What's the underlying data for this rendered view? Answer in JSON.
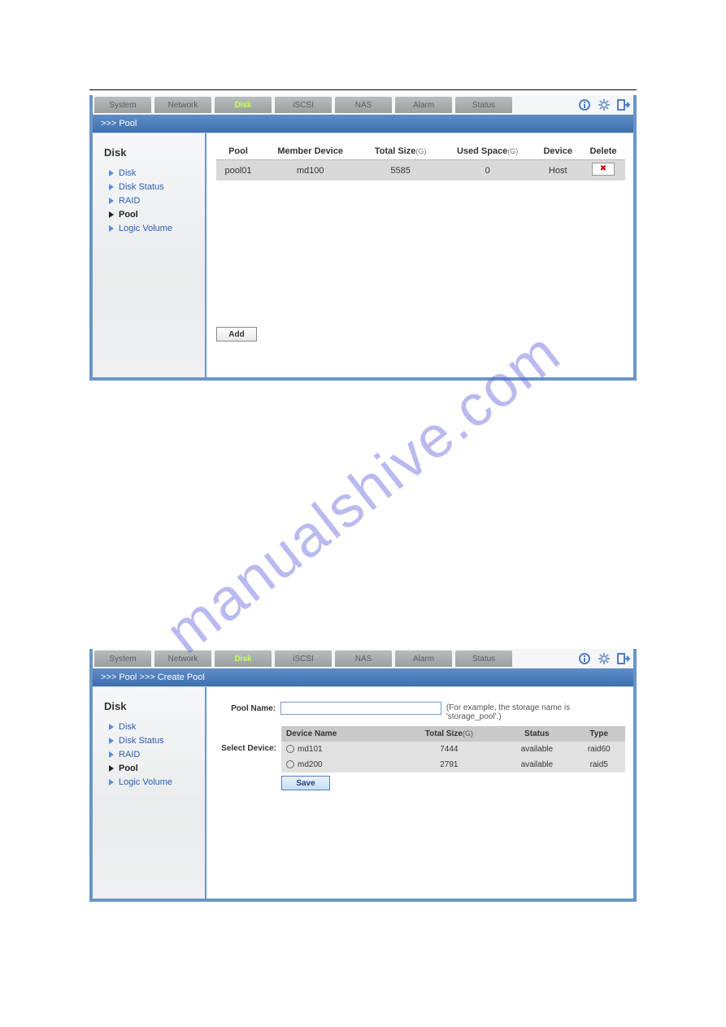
{
  "watermark": "manualshive.com",
  "screen1": {
    "tabs": [
      "System",
      "Network",
      "Disk",
      "iSCSI",
      "NAS",
      "Alarm",
      "Status"
    ],
    "activeTab": "Disk",
    "breadcrumb": ">>> Pool",
    "sidebar": {
      "header": "Disk",
      "items": [
        {
          "label": "Disk",
          "active": false
        },
        {
          "label": "Disk Status",
          "active": false
        },
        {
          "label": "RAID",
          "active": false
        },
        {
          "label": "Pool",
          "active": true
        },
        {
          "label": "Logic Volume",
          "active": false
        }
      ]
    },
    "table": {
      "cols": [
        {
          "label": "Pool",
          "unit": ""
        },
        {
          "label": "Member Device",
          "unit": ""
        },
        {
          "label": "Total Size",
          "unit": "(G)"
        },
        {
          "label": "Used Space",
          "unit": "(G)"
        },
        {
          "label": "Device",
          "unit": ""
        },
        {
          "label": "Delete",
          "unit": ""
        }
      ],
      "rows": [
        {
          "pool": "pool01",
          "member": "md100",
          "total": "5585",
          "used": "0",
          "device": "Host"
        }
      ]
    },
    "addLabel": "Add"
  },
  "screen2": {
    "tabs": [
      "System",
      "Network",
      "Disk",
      "iSCSI",
      "NAS",
      "Alarm",
      "Status"
    ],
    "activeTab": "Disk",
    "breadcrumb": ">>> Pool >>> Create Pool",
    "sidebar": {
      "header": "Disk",
      "items": [
        {
          "label": "Disk",
          "active": false
        },
        {
          "label": "Disk Status",
          "active": false
        },
        {
          "label": "RAID",
          "active": false
        },
        {
          "label": "Pool",
          "active": true
        },
        {
          "label": "Logic Volume",
          "active": false
        }
      ]
    },
    "form": {
      "poolNameLabel": "Pool Name:",
      "poolNameValue": "",
      "poolNameHint": "(For example, the storage name is 'storage_pool'.)",
      "selectDeviceLabel": "Select Device:",
      "cols": [
        {
          "label": "Device Name",
          "unit": ""
        },
        {
          "label": "Total Size",
          "unit": "(G)"
        },
        {
          "label": "Status",
          "unit": ""
        },
        {
          "label": "Type",
          "unit": ""
        }
      ],
      "rows": [
        {
          "name": "md101",
          "total": "7444",
          "status": "available",
          "type": "raid60"
        },
        {
          "name": "md200",
          "total": "2791",
          "status": "available",
          "type": "raid5"
        }
      ],
      "saveLabel": "Save"
    }
  }
}
